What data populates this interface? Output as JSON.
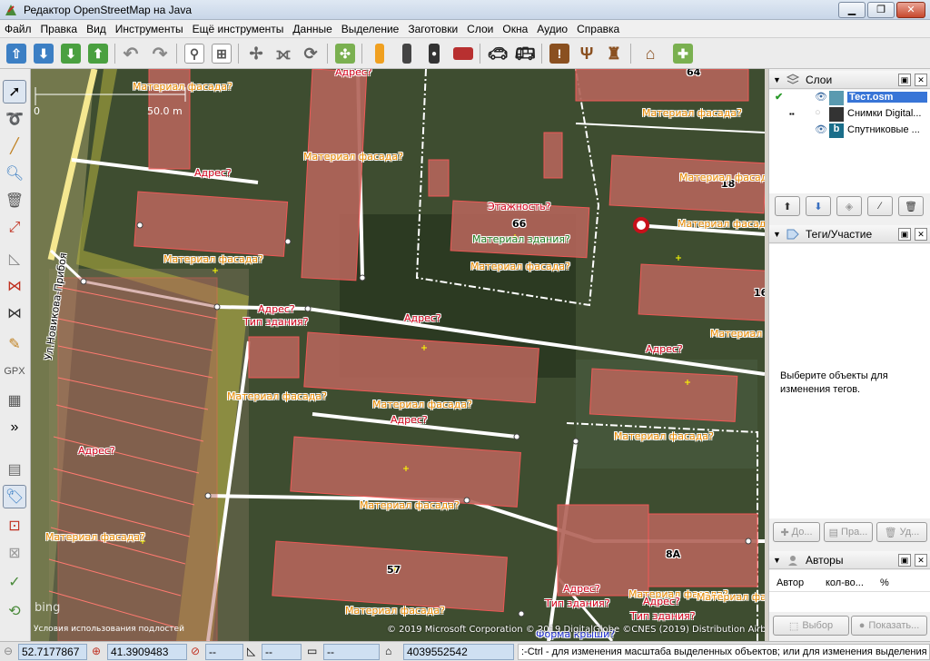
{
  "window": {
    "title": "Редактор OpenStreetMap на Java",
    "min": "▁",
    "max": "❐",
    "close": "✕"
  },
  "menu": [
    "Файл",
    "Правка",
    "Вид",
    "Инструменты",
    "Ещё инструменты",
    "Данные",
    "Выделение",
    "Заготовки",
    "Слои",
    "Окна",
    "Аудио",
    "Справка"
  ],
  "toolbar": {
    "icons": [
      "open-icon",
      "download-icon",
      "download-data-icon",
      "upload-icon",
      "undo-icon",
      "redo-icon",
      "preferences-icon",
      "wireframe-icon",
      "simplify-icon",
      "combine-icon",
      "refresh-icon",
      "validate-icon",
      "road-icon",
      "road-marked-icon",
      "traffic-light-icon",
      "wall-icon",
      "car-icon",
      "bus-icon",
      "alert-icon",
      "restaurant-icon",
      "castle-icon",
      "factory-icon",
      "gps-icon"
    ]
  },
  "lefttools": [
    "select-icon",
    "lasso-icon",
    "draw-icon",
    "zoom-icon",
    "delete-icon",
    "split-icon",
    "parallel-icon",
    "measure-icon",
    "align-icon",
    "scissors-icon",
    "pencil-icon",
    "gpx-icon",
    "imagery-icon",
    "more-icon",
    "layers-toggle-icon",
    "tags-toggle-icon",
    "relation-icon",
    "selection-icon",
    "validation-icon",
    "history-icon"
  ],
  "map": {
    "scale": {
      "zero": "0",
      "length": "50.0 m"
    },
    "street": "Ул.Новикова-Прибоя",
    "attribution": "© 2019 Microsoft Corporation © 2019 DigitalGlobe ©CNES (2019) Distribution Airbus DS",
    "terms": "Условия использования подлостей",
    "bing": "bing",
    "labels": [
      {
        "t": "Материал фасада?",
        "c": "o"
      },
      {
        "t": "Адрес?",
        "c": "r"
      },
      {
        "t": "Материал фасада?",
        "c": "o"
      },
      {
        "t": "Материал фасада?",
        "c": "o"
      },
      {
        "t": "Адрес?",
        "c": "r"
      },
      {
        "t": "18",
        "c": "n"
      },
      {
        "t": "Этажность?",
        "c": "r"
      },
      {
        "t": "66",
        "c": "n"
      },
      {
        "t": "Материал здания?",
        "c": "g"
      },
      {
        "t": "Материал фасада?",
        "c": "o"
      },
      {
        "t": "Материал фасада?",
        "c": "o"
      },
      {
        "t": "Материал фасада?",
        "c": "o"
      },
      {
        "t": "16",
        "c": "n"
      },
      {
        "t": "Адрес?",
        "c": "r"
      },
      {
        "t": "Тип здания?",
        "c": "r"
      },
      {
        "t": "Адрес?",
        "c": "r"
      },
      {
        "t": "Адрес?",
        "c": "r"
      },
      {
        "t": "Материал фасада?",
        "c": "o"
      },
      {
        "t": "Материал фасада?",
        "c": "o"
      },
      {
        "t": "Материал фасада?",
        "c": "o"
      },
      {
        "t": "Адрес?",
        "c": "r"
      },
      {
        "t": "Адрес?",
        "c": "r"
      },
      {
        "t": "Материал фасада?",
        "c": "o"
      },
      {
        "t": "Материал фасада?",
        "c": "o"
      },
      {
        "t": "Материал фасада?",
        "c": "o"
      },
      {
        "t": "57",
        "c": "n"
      },
      {
        "t": "8А",
        "c": "n"
      },
      {
        "t": "Адрес?",
        "c": "r"
      },
      {
        "t": "Тип здания?",
        "c": "r"
      },
      {
        "t": "Материал фасада?",
        "c": "o"
      },
      {
        "t": "Адрес?",
        "c": "r"
      },
      {
        "t": "Тип здания?",
        "c": "r"
      },
      {
        "t": "Материал фасада?",
        "c": "o"
      },
      {
        "t": "Материал фасада?",
        "c": "o"
      },
      {
        "t": "64",
        "c": "n"
      },
      {
        "t": "Материал фасада?",
        "c": "o"
      },
      {
        "t": "Форма крыши?",
        "c": "b"
      }
    ]
  },
  "layers": {
    "title": "Слои",
    "items": [
      {
        "name": "Тест.osm",
        "active": true
      },
      {
        "name": "Снимки Digital...",
        "active": false
      },
      {
        "name": "Спутниковые ...",
        "active": false
      }
    ]
  },
  "tags": {
    "title": "Теги/Участие",
    "empty": "Выберите объекты для изменения тегов.",
    "add": "До...",
    "edit": "Пра...",
    "delete": "Уд..."
  },
  "authors": {
    "title": "Авторы",
    "cols": [
      "Автор",
      "кол-во...",
      "%"
    ],
    "select": "Выбор",
    "show": "Показать..."
  },
  "status": {
    "lat": "52.7177867",
    "lon": "41.3909483",
    "heading": "--",
    "angle": "--",
    "length": "--",
    "id": "4039552542",
    "help": ":-Ctrl - для изменения масштаба выделенных объектов; или для изменения выделения"
  }
}
